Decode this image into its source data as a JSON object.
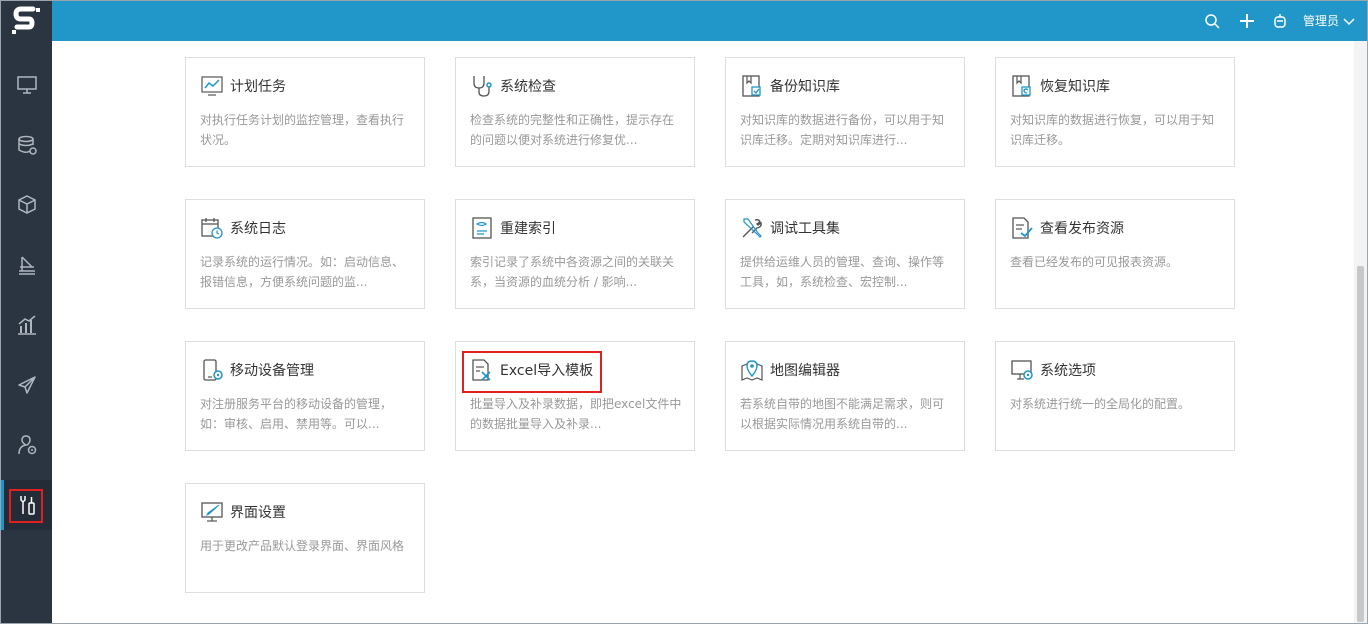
{
  "app": {
    "logo": "S"
  },
  "sidebar": {
    "items": [
      {
        "icon": "monitor-icon"
      },
      {
        "icon": "database-settings-icon"
      },
      {
        "icon": "cube-icon"
      },
      {
        "icon": "layers-icon"
      },
      {
        "icon": "bar-chart-icon"
      },
      {
        "icon": "send-icon"
      },
      {
        "icon": "user-settings-icon"
      },
      {
        "icon": "tools-icon",
        "active": true
      }
    ]
  },
  "topbar": {
    "user_label": "管理员",
    "icons": [
      "search-icon",
      "plus-icon",
      "robot-icon",
      "chevron-down-icon"
    ]
  },
  "cards": [
    {
      "title": "计划任务",
      "desc1": "对执行任务计划的监控管理，查看执行",
      "desc2": "状况。"
    },
    {
      "title": "系统检查",
      "desc1": "检查系统的完整性和正确性，提示存在",
      "desc2": "的问题以便对系统进行修复优..."
    },
    {
      "title": "备份知识库",
      "desc1": "对知识库的数据进行备份，可以用于知",
      "desc2": "识库迁移。定期对知识库进行..."
    },
    {
      "title": "恢复知识库",
      "desc1": "对知识库的数据进行恢复，可以用于知",
      "desc2": "识库迁移。"
    },
    {
      "title": "系统日志",
      "desc1": "记录系统的运行情况。如：启动信息、",
      "desc2": "报错信息，方便系统问题的监..."
    },
    {
      "title": "重建索引",
      "desc1": "索引记录了系统中各资源之间的关联关",
      "desc2": "系，当资源的血统分析 / 影响..."
    },
    {
      "title": "调试工具集",
      "desc1": "提供给运维人员的管理、查询、操作等",
      "desc2": "工具，如，系统检查、宏控制..."
    },
    {
      "title": "查看发布资源",
      "desc1": "查看已经发布的可见报表资源。",
      "desc2": ""
    },
    {
      "title": "移动设备管理",
      "desc1": "对注册服务平台的移动设备的管理，",
      "desc2": "如：审核、启用、禁用等。可以..."
    },
    {
      "title": "Excel导入模板",
      "desc1": "批量导入及补录数据，即把excel文件中",
      "desc2": "的数据批量导入及补录..."
    },
    {
      "title": "地图编辑器",
      "desc1": "若系统自带的地图不能满足需求，则可",
      "desc2": "以根据实际情况用系统自带的..."
    },
    {
      "title": "系统选项",
      "desc1": "对系统进行统一的全局化的配置。",
      "desc2": ""
    },
    {
      "title": "界面设置",
      "desc1": "用于更改产品默认登录界面、界面风格",
      "desc2": ""
    }
  ]
}
